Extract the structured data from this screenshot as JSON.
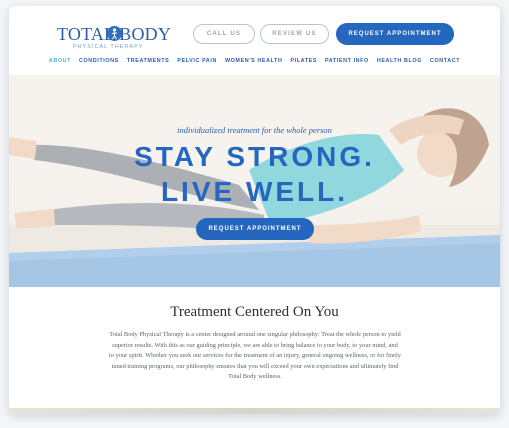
{
  "brand": {
    "logo_text": "TOTAL BODY",
    "logo_subtext": "PHYSICAL THERAPY",
    "primary_color": "#2566be",
    "accent_color": "#4fb3e0"
  },
  "header": {
    "call_us_label": "CALL US",
    "review_us_label": "REVIEW US",
    "request_label": "REQUEST APPOINTMENT"
  },
  "nav": {
    "items": [
      {
        "label": "ABOUT"
      },
      {
        "label": "CONDITIONS"
      },
      {
        "label": "TREATMENTS"
      },
      {
        "label": "PELVIC PAIN"
      },
      {
        "label": "WOMEN'S HEALTH"
      },
      {
        "label": "PILATES"
      },
      {
        "label": "PATIENT INFO"
      },
      {
        "label": "HEALTH BLOG"
      },
      {
        "label": "CONTACT"
      }
    ]
  },
  "hero": {
    "tagline": "individualized treatment for the whole person",
    "headline_line1": "STAY STRONG.",
    "headline_line2": "LIVE WELL.",
    "cta_label": "REQUEST APPOINTMENT"
  },
  "intro": {
    "title": "Treatment Centered On You",
    "lines": [
      "Total Body Physical Therapy is a center designed around one singular philosophy: Treat the whole person to yield",
      "superior results.  With this as our guiding principle, we are able to bring balance to your body, to your mind, and",
      "to your spirit.  Whether you seek our services for the treatment of an injury, general ongoing wellness, or for finely",
      "tuned training programs, our philosophy ensures that you will exceed your own expectations and ultimately find",
      "Total Body wellness."
    ]
  }
}
